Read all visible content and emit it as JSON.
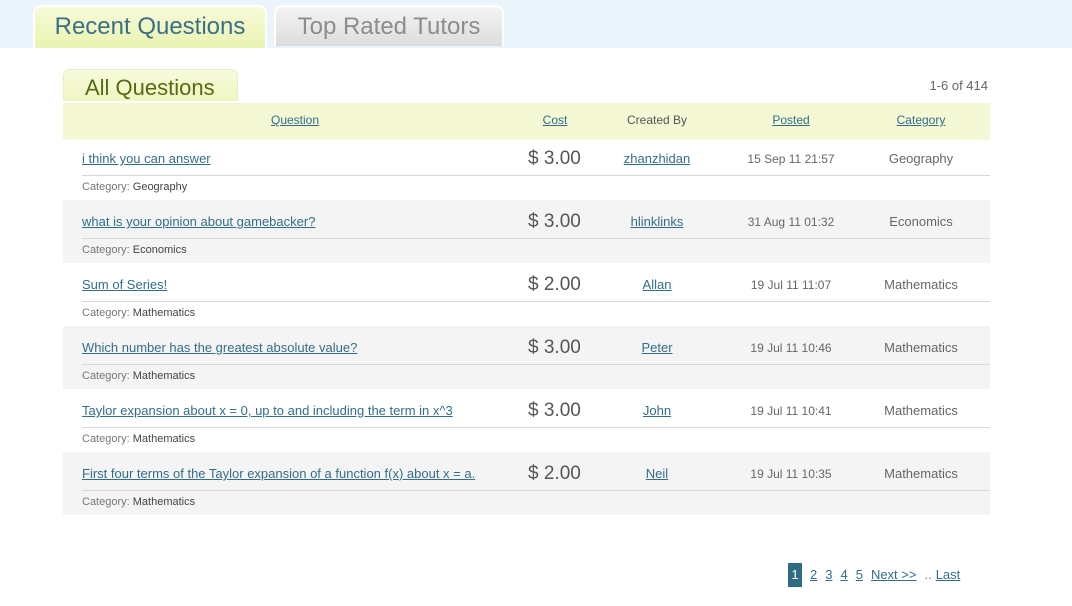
{
  "tabs": {
    "recent": "Recent Questions",
    "top_rated": "Top Rated Tutors"
  },
  "section": {
    "title": "All Questions",
    "count": "1-6 of 414"
  },
  "columns": {
    "question": "Question",
    "cost": "Cost",
    "created_by": "Created By",
    "posted": "Posted",
    "category": "Category"
  },
  "category_prefix": "Category:",
  "rows": [
    {
      "question": "i think you can answer",
      "cost": "$ 3.00",
      "author": "zhanzhidan",
      "posted": "15 Sep 11 21:57",
      "category": "Geography"
    },
    {
      "question": "what is your opinion about gamebacker?",
      "cost": "$ 3.00",
      "author": "hlinklinks",
      "posted": "31 Aug 11 01:32",
      "category": "Economics"
    },
    {
      "question": "Sum of Series!",
      "cost": "$ 2.00",
      "author": "Allan",
      "posted": "19 Jul 11 11:07",
      "category": "Mathematics"
    },
    {
      "question": "Which number has the greatest absolute value?",
      "cost": "$ 3.00",
      "author": "Peter",
      "posted": "19 Jul 11 10:46",
      "category": "Mathematics"
    },
    {
      "question": "Taylor expansion about x = 0, up to and including the term in x^3",
      "cost": "$ 3.00",
      "author": "John",
      "posted": "19 Jul 11 10:41",
      "category": "Mathematics"
    },
    {
      "question": "First four terms of the Taylor expansion of a function f(x) about x = a.",
      "cost": "$ 2.00",
      "author": "Neil",
      "posted": "19 Jul 11 10:35",
      "category": "Mathematics"
    }
  ],
  "pager": {
    "pages": [
      "1",
      "2",
      "3",
      "4",
      "5"
    ],
    "current": "1",
    "next": "Next >>",
    "sep": "..",
    "last": "Last"
  }
}
